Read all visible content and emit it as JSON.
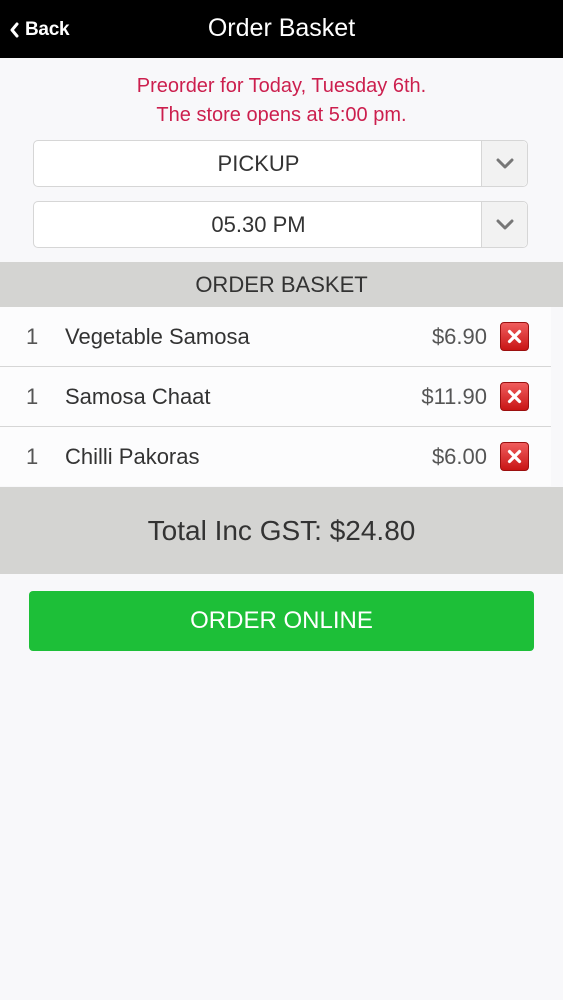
{
  "nav": {
    "back_label": "Back",
    "title": "Order Basket"
  },
  "notice": {
    "line1": "Preorder for Today, Tuesday 6th.",
    "line2": "The store opens at 5:00 pm."
  },
  "order_type": {
    "selected": "PICKUP"
  },
  "pickup_time": {
    "selected": "05.30 PM"
  },
  "basket": {
    "heading": "ORDER BASKET",
    "items": [
      {
        "qty": "1",
        "name": "Vegetable Samosa",
        "price": "$6.90"
      },
      {
        "qty": "1",
        "name": "Samosa Chaat",
        "price": "$11.90"
      },
      {
        "qty": "1",
        "name": "Chilli Pakoras",
        "price": "$6.00"
      }
    ]
  },
  "total": {
    "label": "Total Inc GST: $24.80"
  },
  "order_button": {
    "label": "ORDER ONLINE"
  },
  "colors": {
    "navbar": "#000000",
    "notice": "#cc1f4e",
    "section_bg": "#d4d4d2",
    "order_button": "#1dbf38",
    "delete_button": "#d42424"
  },
  "icons": {
    "back": "chevron-left-icon",
    "dropdown": "chevron-down-icon",
    "delete": "close-icon"
  }
}
